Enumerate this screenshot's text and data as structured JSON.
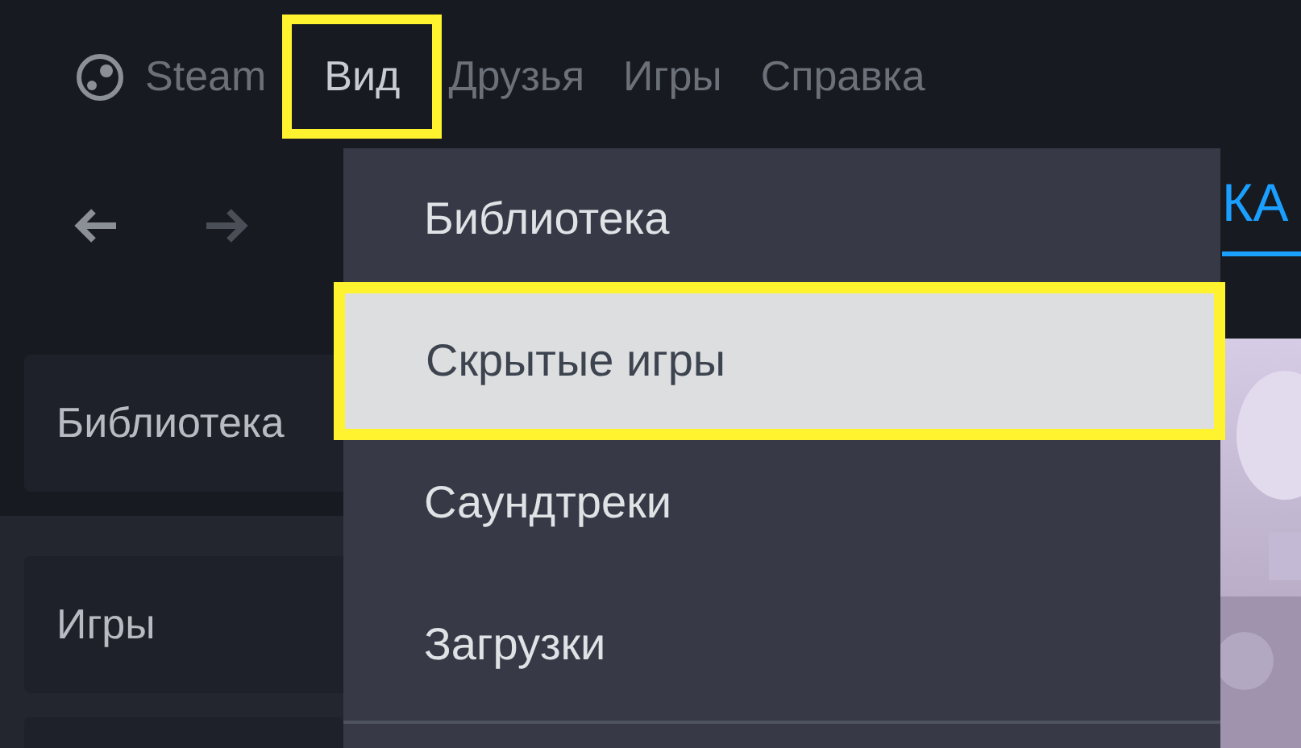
{
  "menu_bar": [
    {
      "label": "Steam",
      "kind": "logo",
      "selected": false,
      "highlighted": false
    },
    {
      "label": "Вид",
      "kind": "plain",
      "selected": true,
      "highlighted": true
    },
    {
      "label": "Друзья",
      "kind": "plain",
      "selected": false,
      "highlighted": false
    },
    {
      "label": "Игры",
      "kind": "plain",
      "selected": false,
      "highlighted": false
    },
    {
      "label": "Справка",
      "kind": "plain",
      "selected": false,
      "highlighted": false
    }
  ],
  "nav_tab_fragment": "КА",
  "sidebar": [
    {
      "label": "Библиотека"
    },
    {
      "label": "Игры"
    }
  ],
  "dropdown": [
    {
      "label": "Библиотека",
      "selected": false,
      "highlighted": false
    },
    {
      "label": "Скрытые игры",
      "selected": true,
      "highlighted": true
    },
    {
      "label": "Саундтреки",
      "selected": false,
      "highlighted": false
    },
    {
      "label": "Загрузки",
      "selected": false,
      "highlighted": false
    }
  ]
}
